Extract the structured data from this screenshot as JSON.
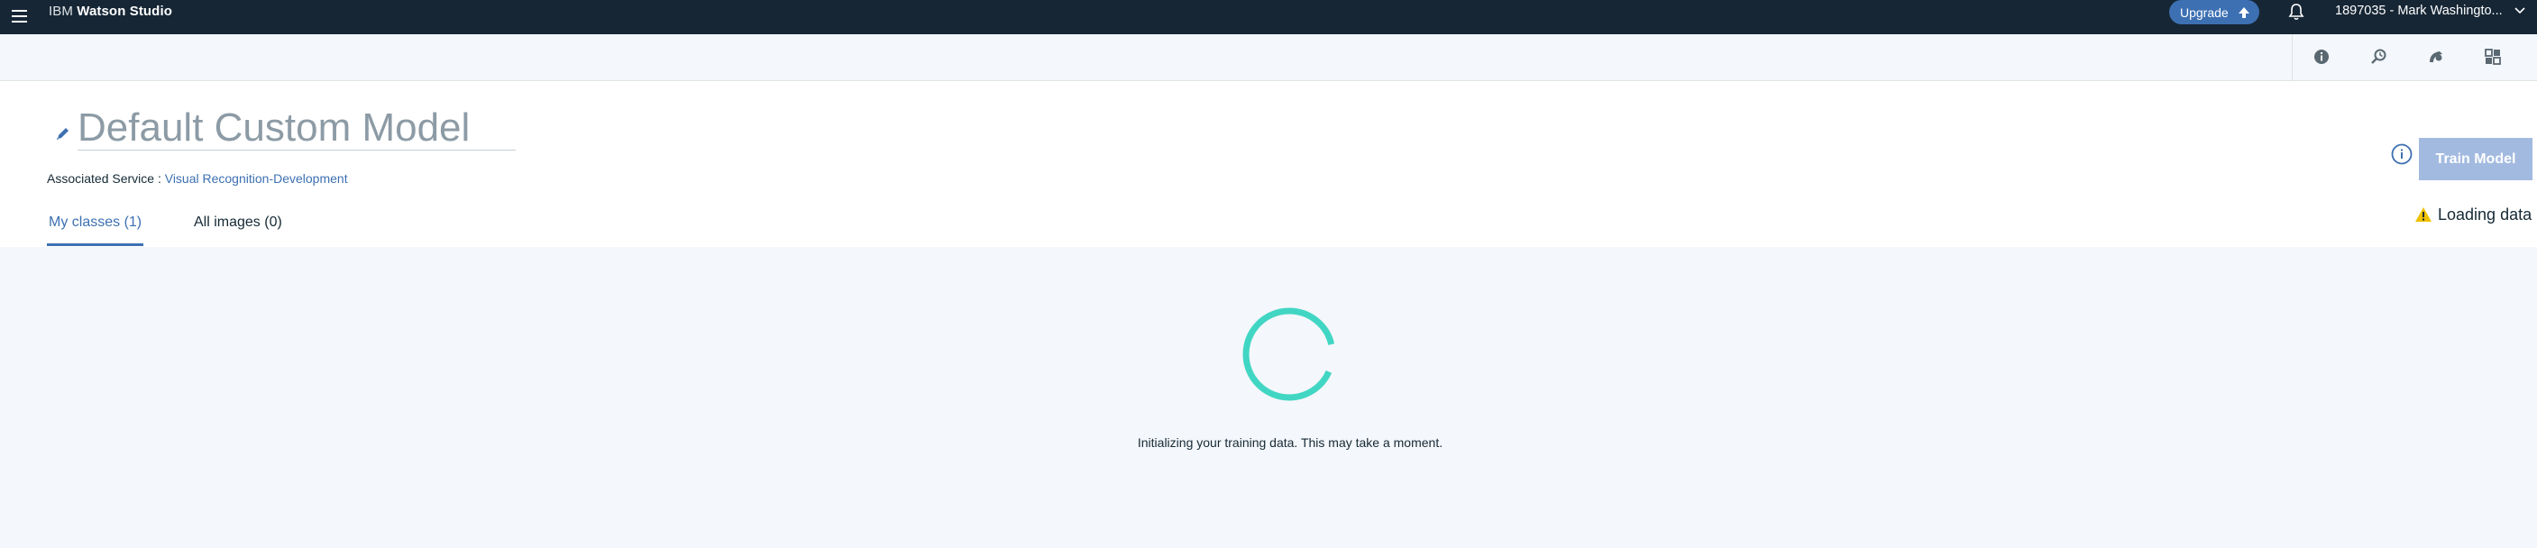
{
  "app": {
    "brand_prefix": "IBM",
    "brand_name": "Watson Studio",
    "upgrade_label": "Upgrade",
    "account_label": "1897035 - Mark Washingto..."
  },
  "toolbar": {
    "icons": [
      "info-icon",
      "find-replace-icon",
      "recognition-icon",
      "dashboard-icon"
    ]
  },
  "model": {
    "name": "Default Custom Model",
    "service_label": "Associated Service :",
    "service_link": "Visual Recognition-Development"
  },
  "tabs": [
    {
      "label": "My classes (1)",
      "active": true
    },
    {
      "label": "All images (0)",
      "active": false
    }
  ],
  "actions": {
    "train_label": "Train Model",
    "loading_label": "Loading data"
  },
  "status": {
    "message": "Initializing your training data. This may take a moment."
  },
  "colors": {
    "topbar": "#162635",
    "accent": "#3d70b2",
    "spinner": "#41d6c3",
    "train_disabled": "#a3bae0",
    "warning": "#efc100"
  }
}
